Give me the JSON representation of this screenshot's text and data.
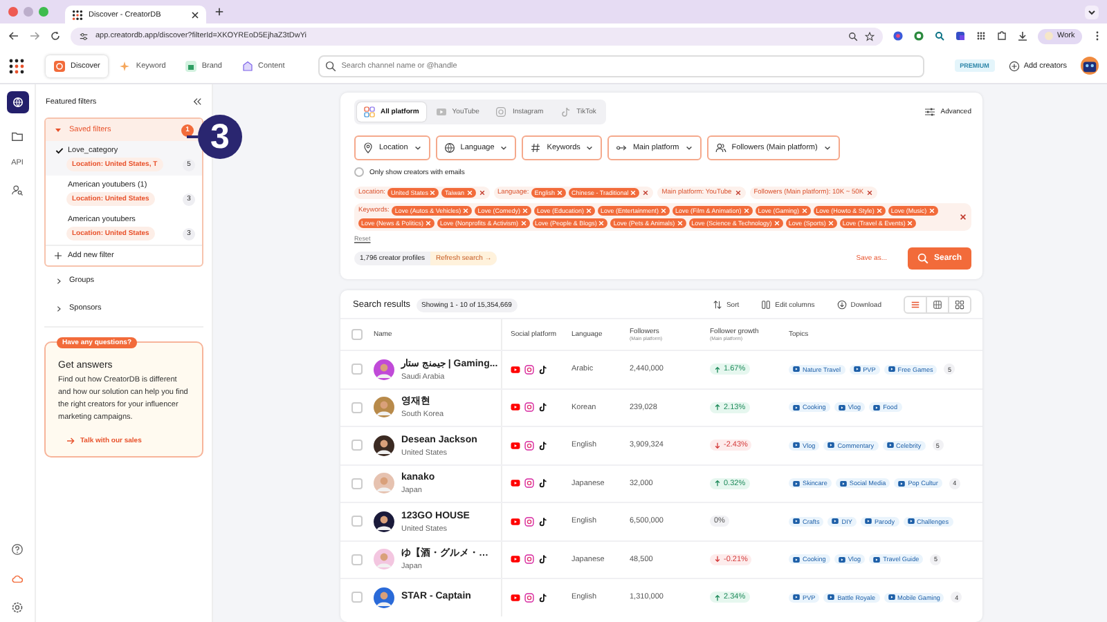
{
  "browser": {
    "tab_title": "Discover - CreatorDB",
    "url": "app.creatordb.app/discover?filterId=XKOYREoD5EjhaZ3tDwYi",
    "profile": "Work"
  },
  "app_nav": {
    "items": [
      {
        "label": "Discover",
        "kind": "discover",
        "selected": true
      },
      {
        "label": "Keyword",
        "kind": "keyword",
        "selected": false
      },
      {
        "label": "Brand",
        "kind": "brand",
        "selected": false
      },
      {
        "label": "Content",
        "kind": "content",
        "selected": false
      }
    ],
    "search_placeholder": "Search channel name or @handle",
    "plan_badge": "PREMIUM",
    "add_button": "Add creators"
  },
  "rail": {
    "api_label": "API"
  },
  "sidebar": {
    "title": "Featured filters",
    "saved": {
      "label": "Saved filters",
      "count": "1",
      "expanded": true,
      "items": [
        {
          "name": "Love_category",
          "filter": "Location: United States, T",
          "count": "5",
          "selected": true
        },
        {
          "name": "American youtubers (1)",
          "filter": "Location: United States",
          "count": "3",
          "selected": false
        },
        {
          "name": "American youtubers",
          "filter": "Location: United States",
          "count": "3",
          "selected": false
        }
      ],
      "add_label": "Add new filter"
    },
    "sections": [
      {
        "label": "Groups",
        "expanded": false
      },
      {
        "label": "Sponsors",
        "expanded": false
      }
    ],
    "help": {
      "badge": "Have any questions?",
      "title": "Get answers",
      "body": "Find out how CreatorDB is different and how our solution can help you find the right creators for your influencer marketing campaigns.",
      "link": "Talk with our sales"
    }
  },
  "annotation": {
    "number": "3"
  },
  "filters": {
    "platforms": [
      {
        "label": "All platform",
        "kind": "all",
        "selected": true
      },
      {
        "label": "YouTube",
        "kind": "youtube",
        "selected": false
      },
      {
        "label": "Instagram",
        "kind": "instagram",
        "selected": false
      },
      {
        "label": "TikTok",
        "kind": "tiktok",
        "selected": false
      }
    ],
    "advanced": "Advanced",
    "dropdowns": [
      {
        "label": "Location",
        "kind": "location"
      },
      {
        "label": "Language",
        "kind": "language"
      },
      {
        "label": "Keywords",
        "kind": "keywords"
      },
      {
        "label": "Main platform",
        "kind": "platform"
      },
      {
        "label": "Followers (Main platform)",
        "kind": "followers"
      }
    ],
    "email_only": {
      "label": "Only show creators with emails",
      "checked": false
    },
    "groups": [
      {
        "label": "Location:",
        "values": [
          "United States",
          "Taiwan"
        ]
      },
      {
        "label": "Language:",
        "values": [
          "English",
          "Chinese - Traditional"
        ]
      },
      {
        "label": "Main platform: YouTube"
      },
      {
        "label": "Followers (Main platform): 10K ~ 50K"
      }
    ],
    "keywords": {
      "label": "Keywords:",
      "values": [
        "Love (Autos & Vehicles)",
        "Love (Comedy)",
        "Love (Education)",
        "Love (Entertainment)",
        "Love (Film & Animation)",
        "Love (Gaming)",
        "Love (Howto & Style)",
        "Love (Music)",
        "Love (News & Politics)",
        "Love (Nonprofits & Activism)",
        "Love (People & Blogs)",
        "Love (Pets & Animals)",
        "Love (Science & Technology)",
        "Love (Sports)",
        "Love (Travel & Events)"
      ]
    },
    "reset": "Reset",
    "profiles": "1,796 creator profiles",
    "refresh": "Refresh search →",
    "save_as": "Save as...",
    "search_button": "Search"
  },
  "results": {
    "title": "Search results",
    "showing": "Showing 1 - 10 of 15,354,669",
    "sort": "Sort",
    "edit_columns": "Edit columns",
    "download": "Download",
    "views": [
      {
        "kind": "list",
        "selected": true
      },
      {
        "kind": "columns",
        "selected": false
      },
      {
        "kind": "grid",
        "selected": false
      }
    ],
    "all_checked": false,
    "columns": [
      {
        "label": "Name"
      },
      {
        "label": "Social platform"
      },
      {
        "label": "Language"
      },
      {
        "label": "Followers",
        "sub": "(Main platform)"
      },
      {
        "label": "Follower growth",
        "sub": "(Main platform)"
      },
      {
        "label": "Topics"
      }
    ],
    "rows": [
      {
        "name": "جيمنج ستار | Gaming...",
        "location": "Saudi Arabia",
        "language": "Arabic",
        "followers": "2,440,000",
        "growth": "1.67%",
        "kind": "up",
        "checked": false,
        "topics": [
          "Nature Travel",
          "PVP",
          "Free Games"
        ],
        "more": "5"
      },
      {
        "name": "영재현",
        "location": "South Korea",
        "language": "Korean",
        "followers": "239,028",
        "growth": "2.13%",
        "kind": "up",
        "checked": false,
        "topics": [
          "Cooking",
          "Vlog",
          "Food"
        ]
      },
      {
        "name": "Desean Jackson",
        "location": "United States",
        "language": "English",
        "followers": "3,909,324",
        "growth": "-2.43%",
        "kind": "down",
        "checked": false,
        "topics": [
          "Vlog",
          "Commentary",
          "Celebrity"
        ],
        "more": "5"
      },
      {
        "name": "kanako",
        "location": "Japan",
        "language": "Japanese",
        "followers": "32,000",
        "growth": "0.32%",
        "kind": "up",
        "checked": false,
        "topics": [
          "Skincare",
          "Social Media",
          "Pop Cultur"
        ],
        "more": "4"
      },
      {
        "name": "123GO HOUSE",
        "location": "United States",
        "language": "English",
        "followers": "6,500,000",
        "growth": "0%",
        "kind": "flat",
        "checked": false,
        "topics": [
          "Crafts",
          "DIY",
          "Parody",
          "Challenges"
        ]
      },
      {
        "name": "ゆ【酒・グルメ・…",
        "location": "Japan",
        "language": "Japanese",
        "followers": "48,500",
        "growth": "-0.21%",
        "kind": "down",
        "checked": false,
        "topics": [
          "Cooking",
          "Vlog",
          "Travel Guide"
        ],
        "more": "5"
      },
      {
        "name": "STAR - Captain",
        "language": "English",
        "followers": "1,310,000",
        "growth": "2.34%",
        "kind": "up",
        "checked": false,
        "topics": [
          "PVP",
          "Battle Royale",
          "Mobile Gaming"
        ],
        "more": "4"
      }
    ]
  }
}
